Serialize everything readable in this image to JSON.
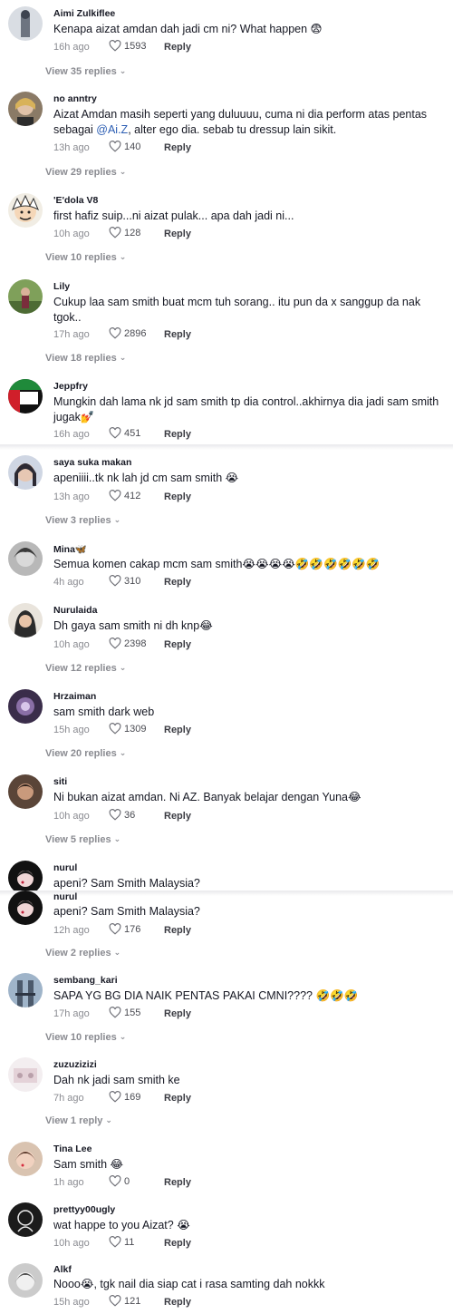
{
  "comments": [
    {
      "user": "Aimi Zulkiflee",
      "text": "Kenapa aizat amdan dah jadi cm ni? What happen 😨",
      "ago": "16h ago",
      "likes": "1593",
      "reply": "Reply",
      "view": "View 35 replies"
    },
    {
      "user": "no anntry",
      "text_pre": "Aizat Amdan masih seperti yang duluuuu, cuma ni dia perform atas pentas sebagai ",
      "mention": "@Ai.Z",
      "text_post": ", alter ego dia. sebab tu dressup lain sikit.",
      "ago": "13h ago",
      "likes": "140",
      "reply": "Reply",
      "view": "View 29 replies"
    },
    {
      "user": "'E'dola V8",
      "text": "first hafiz suip...ni aizat pulak... apa dah jadi ni...",
      "ago": "10h ago",
      "likes": "128",
      "reply": "Reply",
      "view": "View 10 replies"
    },
    {
      "user": "Lily",
      "text": "Cukup laa sam smith buat mcm tuh sorang.. itu pun da x sanggup da nak tgok..",
      "ago": "17h ago",
      "likes": "2896",
      "reply": "Reply",
      "view": "View 18 replies"
    },
    {
      "user": "Jeppfry",
      "text": "Mungkin dah lama nk jd sam smith tp dia control..akhirnya dia jadi sam smith jugak💅",
      "ago": "16h ago",
      "likes": "451",
      "reply": "Reply"
    },
    {
      "user": "saya suka makan",
      "text": "apeniiii..tk nk lah jd cm sam smith 😭",
      "ago": "13h ago",
      "likes": "412",
      "reply": "Reply",
      "view": "View 3 replies"
    },
    {
      "user": "Mina🦋",
      "text": "Semua komen cakap mcm sam smith😭😭😭😭🤣🤣🤣🤣🤣🤣",
      "ago": "4h ago",
      "likes": "310",
      "reply": "Reply"
    },
    {
      "user": "Nurulaida",
      "text": "Dh gaya sam smith ni dh knp😂",
      "ago": "10h ago",
      "likes": "2398",
      "reply": "Reply",
      "view": "View 12 replies"
    },
    {
      "user": "Hrzaiman",
      "text": "sam smith dark web",
      "ago": "15h ago",
      "likes": "1309",
      "reply": "Reply",
      "view": "View 20 replies"
    },
    {
      "user": "siti",
      "text": "Ni bukan aizat amdan. Ni AZ. Banyak belajar dengan Yuna😂",
      "ago": "10h ago",
      "likes": "36",
      "reply": "Reply",
      "view": "View 5 replies"
    },
    {
      "user": "nurul",
      "text": "apeni? Sam Smith Malaysia?"
    },
    {
      "user": "nurul",
      "text": "apeni? Sam Smith Malaysia?",
      "ago": "12h ago",
      "likes": "176",
      "reply": "Reply",
      "view": "View 2 replies"
    },
    {
      "user": "sembang_kari",
      "text": "SAPA YG BG DIA NAIK PENTAS PAKAI CMNI???? 🤣🤣🤣",
      "ago": "17h ago",
      "likes": "155",
      "reply": "Reply",
      "view": "View 10 replies"
    },
    {
      "user": "zuzuzizizi",
      "text": "Dah nk jadi sam smith ke",
      "ago": "7h ago",
      "likes": "169",
      "reply": "Reply",
      "view": "View 1 reply"
    },
    {
      "user": "Tina Lee",
      "text": "Sam smith 😂",
      "ago": "1h ago",
      "likes": "0",
      "reply": "Reply"
    },
    {
      "user": "prettyy00ugly",
      "text": "wat happe to you Aizat? 😭",
      "ago": "10h ago",
      "likes": "11",
      "reply": "Reply"
    },
    {
      "user": "Alkf",
      "text": "Nooo😭, tgk nail dia siap cat i rasa samting dah nokkk",
      "ago": "15h ago",
      "likes": "121",
      "reply": "Reply"
    }
  ],
  "icons": {
    "like": "heart-outline-icon",
    "expand": "chevron-down-icon"
  },
  "colors": {
    "text": "#161823",
    "muted": "#8a8b91",
    "mention": "#2b5db3"
  }
}
